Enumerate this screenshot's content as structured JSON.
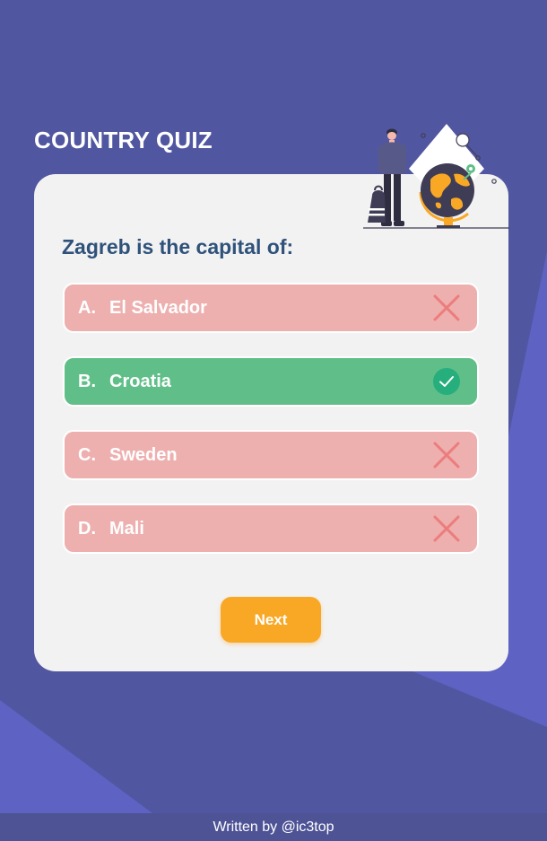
{
  "app": {
    "title": "COUNTRY QUIZ"
  },
  "quiz": {
    "question": "Zagreb is the capital of:",
    "options": [
      {
        "letter": "A.",
        "text": "El Salvador",
        "state": "wrong",
        "icon": "close-icon"
      },
      {
        "letter": "B.",
        "text": "Croatia",
        "state": "correct",
        "icon": "check-circle-icon"
      },
      {
        "letter": "C.",
        "text": "Sweden",
        "state": "wrong",
        "icon": "close-icon"
      },
      {
        "letter": "D.",
        "text": "Mali",
        "state": "wrong",
        "icon": "close-icon"
      }
    ],
    "next_label": "Next"
  },
  "footer": {
    "text": "Written by @ic3top"
  },
  "colors": {
    "background": "#5156a0",
    "card": "#f2f2f2",
    "wrong": "#eeafaf",
    "correct": "#60bf88",
    "accent": "#f9a826",
    "question": "#2f527b"
  }
}
